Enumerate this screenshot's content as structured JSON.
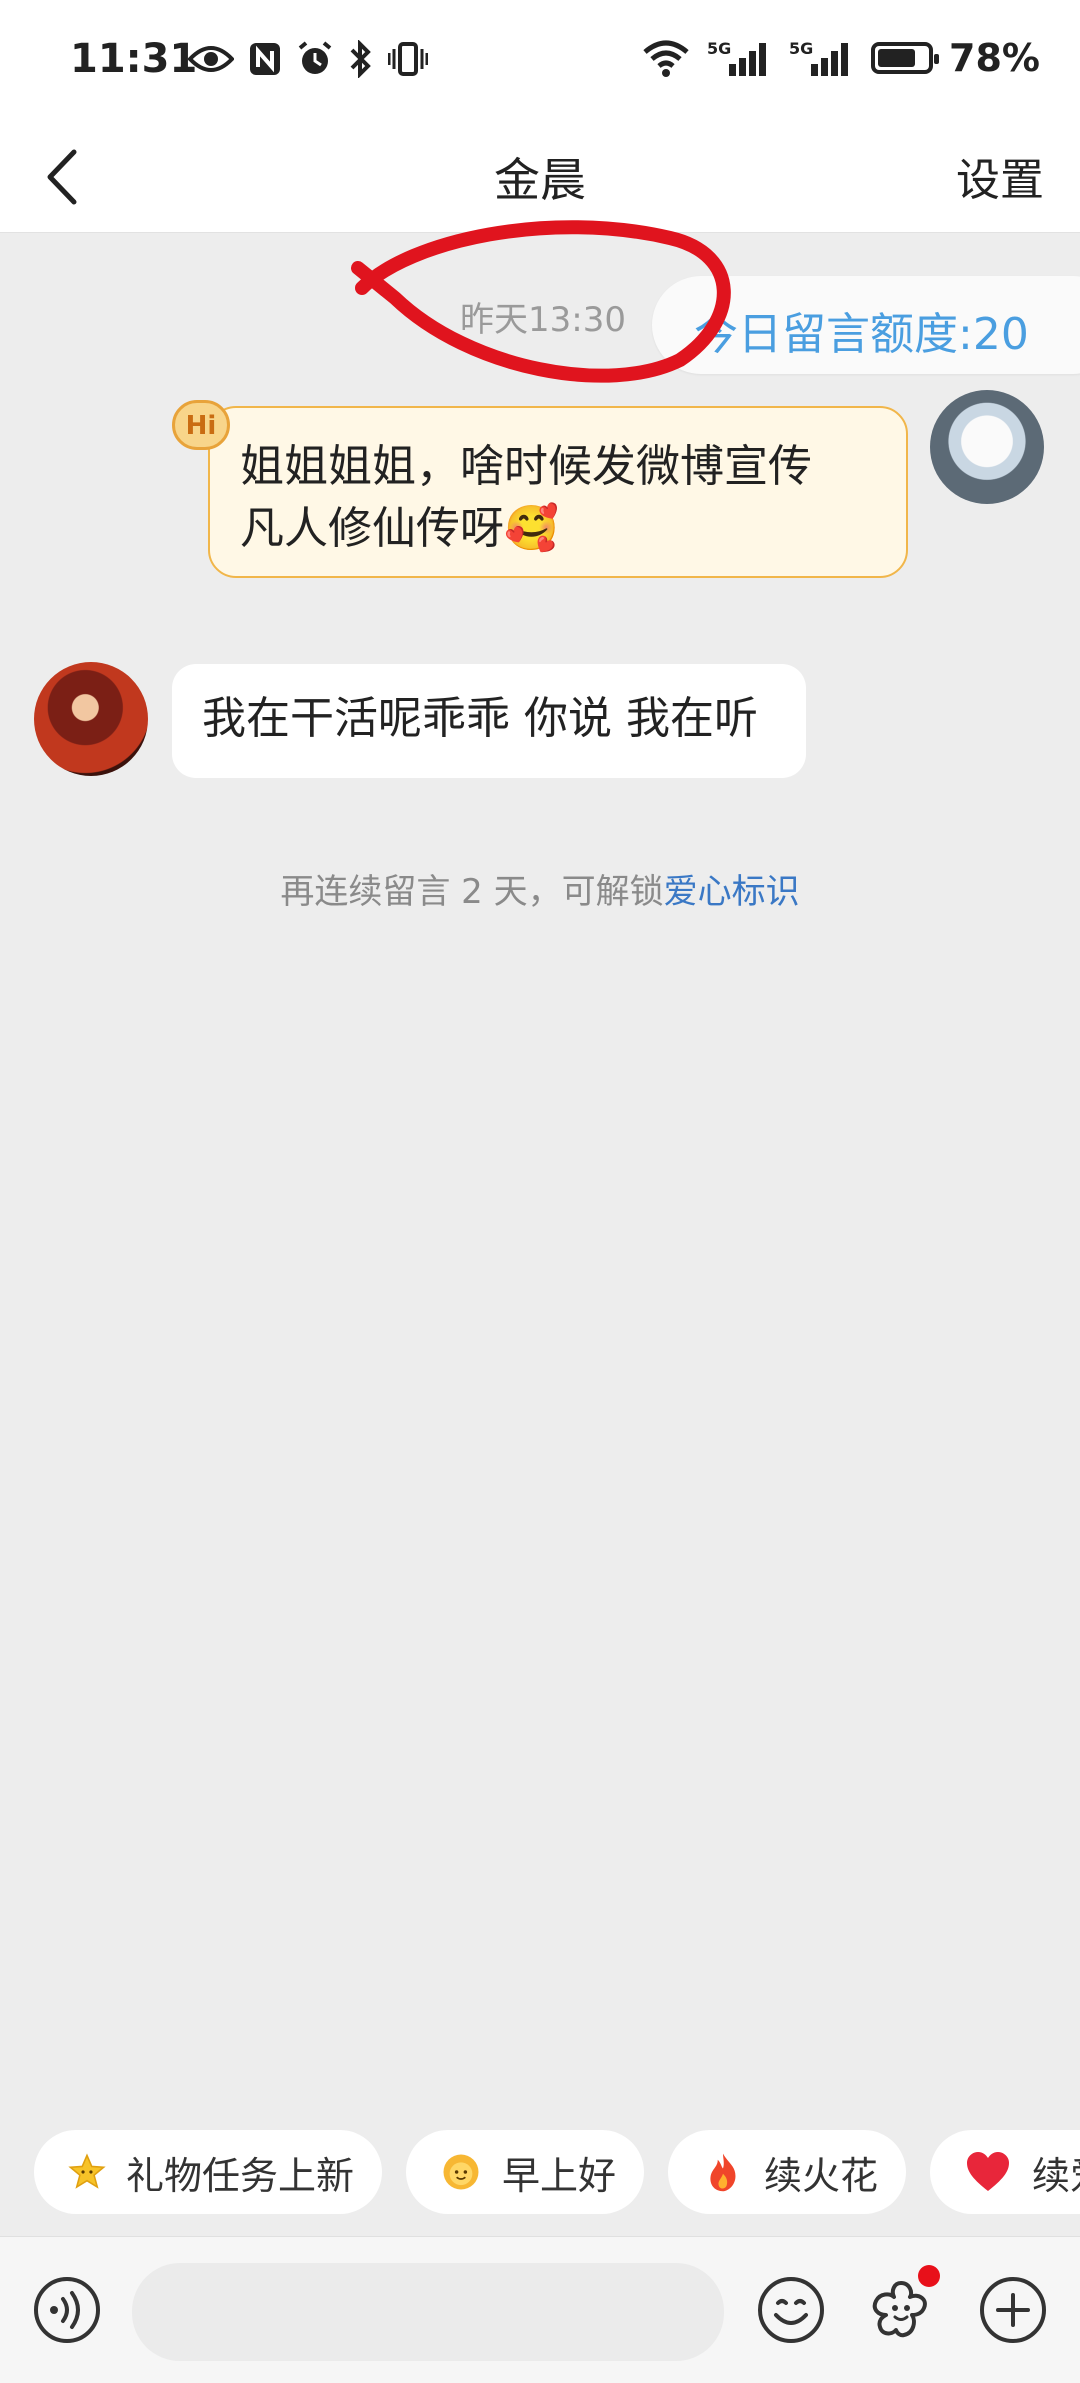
{
  "status_bar": {
    "time": "11:31",
    "battery": "78%",
    "battery_level": 0.78,
    "network_1": "5G",
    "network_2": "5G"
  },
  "header": {
    "title": "金晨",
    "settings": "设置"
  },
  "chat": {
    "timestamp": "昨天13:30",
    "quota_text": "今日留言额度:20",
    "messages": [
      {
        "from": "me",
        "line1": "姐姐姐姐，啥时候发微博宣传",
        "line2": "凡人修仙传呀🥰",
        "badge": "Hi"
      },
      {
        "from": "other",
        "text": "我在干活呢乖乖 你说 我在听"
      }
    ],
    "unlock_hint_prefix": "再连续留言 2 天，可解锁",
    "unlock_hint_link": "爱心标识"
  },
  "quick_chips": [
    {
      "label": "礼物任务上新",
      "icon": "star-emoji"
    },
    {
      "label": "早上好",
      "icon": "sun-emoji"
    },
    {
      "label": "续火花",
      "icon": "fire-emoji"
    },
    {
      "label": "续爱",
      "icon": "heart-emoji"
    }
  ],
  "input": {
    "placeholder": ""
  },
  "colors": {
    "accent_blue": "#4a9ee0",
    "bubble_me_bg": "#fff8e6",
    "bubble_me_border": "#f1b64a",
    "annotation_red": "#e0141e",
    "notification_dot": "#e8101a"
  }
}
